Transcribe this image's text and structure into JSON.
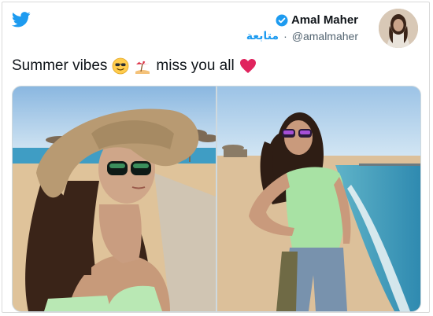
{
  "author": {
    "display_name": "Amal Maher",
    "handle": "@amalmaher",
    "follow_label": "متابعة",
    "separator": "·"
  },
  "tweet": {
    "text_start": "Summer vibes",
    "text_end": "miss you all"
  },
  "icons": [
    "twitter-icon",
    "verified-icon",
    "smiling-face-sunglasses-icon",
    "beach-umbrella-icon",
    "red-heart-icon"
  ],
  "colors": {
    "twitter_blue": "#1d9bf0",
    "heart_red": "#e0245e",
    "secondary_text": "#536471"
  }
}
